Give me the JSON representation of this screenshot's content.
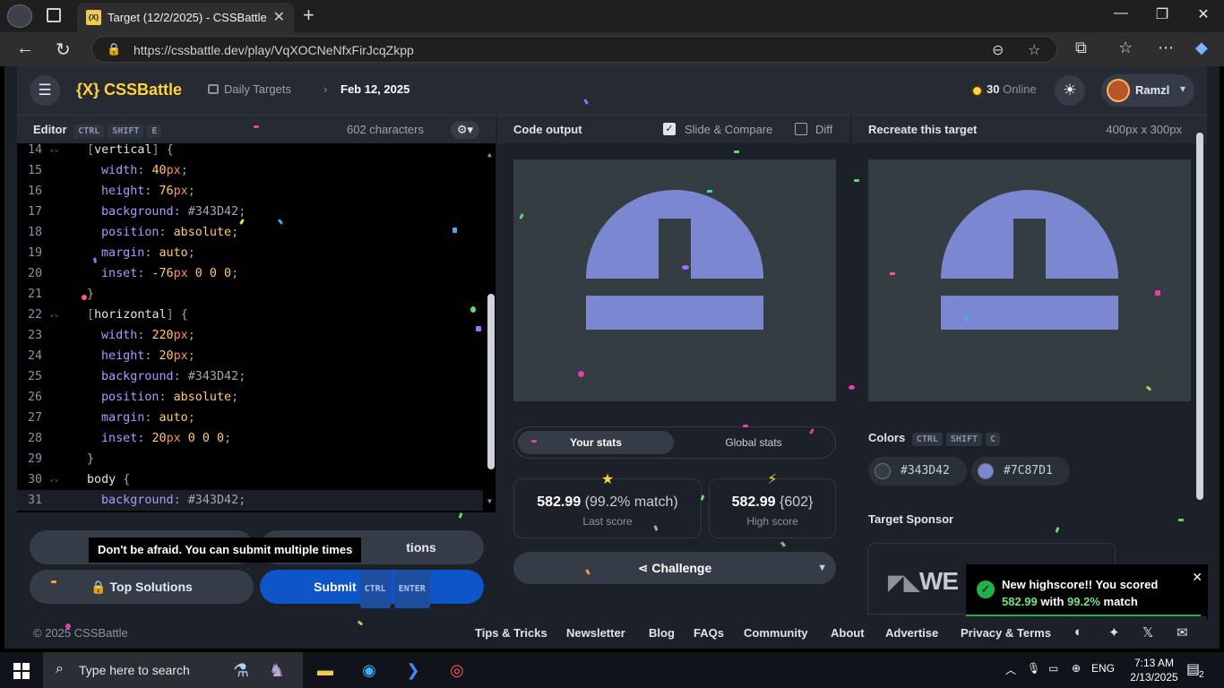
{
  "browser": {
    "tab_title": "Target (12/2/2025) - CSSBattle",
    "favicon_text": "{X}",
    "url": "https://cssbattle.dev/play/VqXOCNeNfxFirJcqZkpp"
  },
  "header": {
    "logo": "{X} CSSBattle",
    "breadcrumb_section": "Daily Targets",
    "breadcrumb_date": "Feb 12, 2025",
    "online_count": "30",
    "online_label": "Online",
    "user_name": "Ramzl"
  },
  "editor": {
    "title": "Editor",
    "shortcut": [
      "CTRL",
      "SHIFT",
      "E"
    ],
    "char_count": "602 characters",
    "lines": [
      {
        "n": "14",
        "fold": true,
        "indent": 1,
        "tokens": [
          [
            "brk",
            "["
          ],
          [
            "sel",
            "vertical"
          ],
          [
            "brk",
            "]"
          ],
          [
            "punct",
            " {"
          ]
        ]
      },
      {
        "n": "15",
        "indent": 2,
        "tokens": [
          [
            "prop",
            "width"
          ],
          [
            "punct",
            ": "
          ],
          [
            "num",
            "40"
          ],
          [
            "unit",
            "px"
          ],
          [
            "punct",
            ";"
          ]
        ]
      },
      {
        "n": "16",
        "indent": 2,
        "tokens": [
          [
            "prop",
            "height"
          ],
          [
            "punct",
            ": "
          ],
          [
            "num",
            "76"
          ],
          [
            "unit",
            "px"
          ],
          [
            "punct",
            ";"
          ]
        ]
      },
      {
        "n": "17",
        "indent": 2,
        "tokens": [
          [
            "prop",
            "background"
          ],
          [
            "punct",
            ": "
          ],
          [
            "hex",
            "#343D42"
          ],
          [
            "punct",
            ";"
          ]
        ]
      },
      {
        "n": "18",
        "indent": 2,
        "tokens": [
          [
            "prop",
            "position"
          ],
          [
            "punct",
            ": "
          ],
          [
            "val",
            "absolute"
          ],
          [
            "punct",
            ";"
          ]
        ]
      },
      {
        "n": "19",
        "indent": 2,
        "tokens": [
          [
            "prop",
            "margin"
          ],
          [
            "punct",
            ": "
          ],
          [
            "val",
            "auto"
          ],
          [
            "punct",
            ";"
          ]
        ]
      },
      {
        "n": "20",
        "indent": 2,
        "tokens": [
          [
            "prop",
            "inset"
          ],
          [
            "punct",
            ": "
          ],
          [
            "num",
            "-76"
          ],
          [
            "unit",
            "px"
          ],
          [
            "num",
            " 0 0 0"
          ],
          [
            "punct",
            ";"
          ]
        ]
      },
      {
        "n": "21",
        "indent": 1,
        "tokens": [
          [
            "punct",
            "}"
          ]
        ]
      },
      {
        "n": "22",
        "fold": true,
        "indent": 1,
        "tokens": [
          [
            "brk",
            "["
          ],
          [
            "sel",
            "horizontal"
          ],
          [
            "brk",
            "]"
          ],
          [
            "punct",
            " {"
          ]
        ]
      },
      {
        "n": "23",
        "indent": 2,
        "tokens": [
          [
            "prop",
            "width"
          ],
          [
            "punct",
            ": "
          ],
          [
            "num",
            "220"
          ],
          [
            "unit",
            "px"
          ],
          [
            "punct",
            ";"
          ]
        ]
      },
      {
        "n": "24",
        "indent": 2,
        "tokens": [
          [
            "prop",
            "height"
          ],
          [
            "punct",
            ": "
          ],
          [
            "num",
            "20"
          ],
          [
            "unit",
            "px"
          ],
          [
            "punct",
            ";"
          ]
        ]
      },
      {
        "n": "25",
        "indent": 2,
        "tokens": [
          [
            "prop",
            "background"
          ],
          [
            "punct",
            ": "
          ],
          [
            "hex",
            "#343D42"
          ],
          [
            "punct",
            ";"
          ]
        ]
      },
      {
        "n": "26",
        "indent": 2,
        "tokens": [
          [
            "prop",
            "position"
          ],
          [
            "punct",
            ": "
          ],
          [
            "val",
            "absolute"
          ],
          [
            "punct",
            ";"
          ]
        ]
      },
      {
        "n": "27",
        "indent": 2,
        "tokens": [
          [
            "prop",
            "margin"
          ],
          [
            "punct",
            ": "
          ],
          [
            "val",
            "auto"
          ],
          [
            "punct",
            ";"
          ]
        ]
      },
      {
        "n": "28",
        "indent": 2,
        "tokens": [
          [
            "prop",
            "inset"
          ],
          [
            "punct",
            ": "
          ],
          [
            "num",
            "20"
          ],
          [
            "unit",
            "px"
          ],
          [
            "num",
            " 0 0 0"
          ],
          [
            "punct",
            ";"
          ]
        ]
      },
      {
        "n": "29",
        "indent": 1,
        "tokens": [
          [
            "punct",
            "}"
          ]
        ]
      },
      {
        "n": "30",
        "fold": true,
        "indent": 1,
        "tokens": [
          [
            "sel",
            "body"
          ],
          [
            "punct",
            " {"
          ]
        ]
      },
      {
        "n": "31",
        "indent": 2,
        "active": true,
        "tokens": [
          [
            "prop",
            "background"
          ],
          [
            "punct",
            ": "
          ],
          [
            "hex",
            "#343D42"
          ],
          [
            "punct",
            ";"
          ]
        ]
      }
    ],
    "tooltip": "Don't be afraid. You can submit multiple times",
    "hidden_button_label": "tions",
    "top_solutions_label": "Top Solutions",
    "submit_label": "Submit",
    "submit_shortcut": [
      "CTRL",
      "ENTER"
    ]
  },
  "output": {
    "title": "Code output",
    "slide_compare_label": "Slide & Compare",
    "slide_compare_checked": true,
    "diff_label": "Diff",
    "diff_checked": false,
    "tabs": [
      "Your stats",
      "Global stats"
    ],
    "last_score": "582.99",
    "last_match": "(99.2% match)",
    "last_label": "Last score",
    "high_score": "582.99",
    "high_chars": "{602}",
    "high_label": "High score",
    "challenge_label": "Challenge"
  },
  "target": {
    "title": "Recreate this target",
    "size": "400px x 300px",
    "colors_title": "Colors",
    "colors_shortcut": [
      "CTRL",
      "SHIFT",
      "C"
    ],
    "colors": [
      {
        "hex": "#343D42",
        "label": "#343D42"
      },
      {
        "hex": "#7C87D1",
        "label": "#7C87D1"
      }
    ],
    "sponsor_title": "Target Sponsor",
    "sponsor_logo": "WE"
  },
  "toast": {
    "line1": "New highscore!! You scored",
    "score": "582.99",
    "with": "with",
    "match": "99.2%",
    "match_suffix": "match",
    "progress": 0.97
  },
  "footer": {
    "copyright": "© 2025 CSSBattle",
    "links": [
      "Tips & Tricks",
      "Newsletter",
      "Blog",
      "FAQs",
      "Community",
      "About",
      "Advertise",
      "Privacy & Terms"
    ]
  },
  "taskbar": {
    "search_placeholder": "Type here to search",
    "language": "ENG",
    "time": "7:13 AM",
    "date": "2/13/2025",
    "notifications": "2"
  },
  "colors": {
    "canvas_bg": "#343D42",
    "shape": "#7C87D1",
    "accent_yellow": "#FFD23F",
    "submit_blue": "#0D55C8",
    "success_green": "#21B04B"
  }
}
